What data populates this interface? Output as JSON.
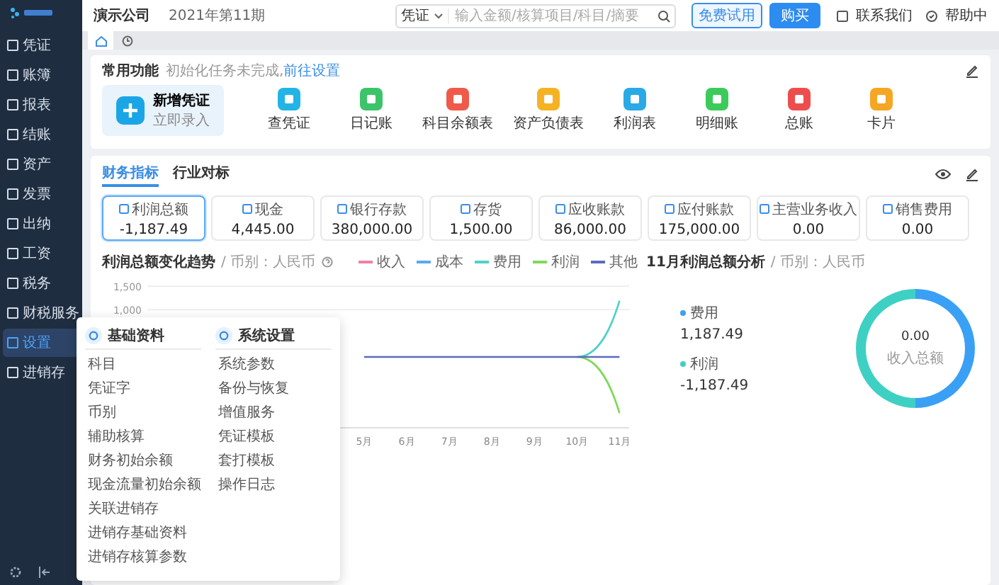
{
  "app": {
    "company": "演示公司",
    "period": "2021年第11期"
  },
  "sidebar": {
    "items": [
      {
        "label": "凭证",
        "selected": false
      },
      {
        "label": "账簿",
        "selected": false
      },
      {
        "label": "报表",
        "selected": false
      },
      {
        "label": "结账",
        "selected": false
      },
      {
        "label": "资产",
        "selected": false
      },
      {
        "label": "发票",
        "selected": false
      },
      {
        "label": "出纳",
        "selected": false
      },
      {
        "label": "工资",
        "selected": false
      },
      {
        "label": "税务",
        "selected": false
      },
      {
        "label": "财税服务",
        "selected": false
      },
      {
        "label": "设置",
        "selected": true
      },
      {
        "label": "进销存",
        "selected": false
      }
    ]
  },
  "search": {
    "scope": "凭证",
    "placeholder": "输入金额/核算项目/科目/摘要"
  },
  "header_actions": {
    "trial_button": "免费试用",
    "buy_button": "购买",
    "contact_link": "联系我们",
    "help_link": "帮助中"
  },
  "quick_functions": {
    "title": "常用功能",
    "hint": "初始化任务未完成,",
    "hint_link": "前往设置",
    "primary": {
      "label": "新增凭证",
      "sublabel": "立即录入"
    },
    "items": [
      {
        "label": "查凭证",
        "color": "#22b4e6"
      },
      {
        "label": "日记账",
        "color": "#3cc46a"
      },
      {
        "label": "科目余额表",
        "color": "#ef5a4a"
      },
      {
        "label": "资产负债表",
        "color": "#f5b324"
      },
      {
        "label": "利润表",
        "color": "#29a9e6"
      },
      {
        "label": "明细账",
        "color": "#3ccb5a"
      },
      {
        "label": "总账",
        "color": "#ee4d4d"
      },
      {
        "label": "卡片",
        "color": "#f5a623"
      }
    ]
  },
  "indicators": {
    "tabs": [
      {
        "label": "财务指标",
        "selected": true
      },
      {
        "label": "行业对标",
        "selected": false
      }
    ],
    "cards": [
      {
        "label": "利润总额",
        "value": "-1,187.49",
        "selected": true
      },
      {
        "label": "现金",
        "value": "4,445.00",
        "selected": false
      },
      {
        "label": "银行存款",
        "value": "380,000.00",
        "selected": false
      },
      {
        "label": "存货",
        "value": "1,500.00",
        "selected": false
      },
      {
        "label": "应收账款",
        "value": "86,000.00",
        "selected": false
      },
      {
        "label": "应付账款",
        "value": "175,000.00",
        "selected": false
      },
      {
        "label": "主营业务收入",
        "value": "0.00",
        "selected": false
      },
      {
        "label": "销售费用",
        "value": "0.00",
        "selected": false
      }
    ]
  },
  "trend_chart": {
    "title": "利润总额变化趋势",
    "unit": "/ 币别：人民币",
    "chart_data": {
      "type": "line",
      "categories": [
        "5月",
        "6月",
        "7月",
        "8月",
        "9月",
        "10月",
        "11月"
      ],
      "ylim": [
        -1500,
        1500
      ],
      "yticks": [
        {
          "value": 1500,
          "label": "1,500"
        },
        {
          "value": 1000,
          "label": "1,000"
        }
      ],
      "series": [
        {
          "name": "收入",
          "color": "#f27fa3",
          "values": [
            null,
            null,
            null,
            null,
            null,
            null,
            null
          ]
        },
        {
          "name": "成本",
          "color": "#5aa9f2",
          "values": [
            null,
            null,
            null,
            null,
            null,
            null,
            null
          ]
        },
        {
          "name": "费用",
          "color": "#4fd1c5",
          "values": [
            null,
            null,
            null,
            null,
            null,
            0,
            1190
          ]
        },
        {
          "name": "利润",
          "color": "#7ed957",
          "values": [
            null,
            null,
            null,
            null,
            null,
            0,
            -1190
          ]
        },
        {
          "name": "其他",
          "color": "#5b6bc0",
          "values": [
            0,
            0,
            0,
            0,
            0,
            0,
            0
          ]
        }
      ]
    }
  },
  "analysis_chart": {
    "title": "11月利润总额分析",
    "unit": "/ 币别：人民币",
    "center_value": "0.00",
    "center_label": "收入总额",
    "legend": [
      {
        "value": "1,187.49",
        "color": "#3aa0f5"
      },
      {
        "value": "-1,187.49",
        "color": "#3fd0c4"
      }
    ],
    "chart_data": {
      "type": "donut",
      "categories": [
        "费用",
        "利润"
      ],
      "values": [
        50,
        50
      ]
    }
  },
  "settings_menu": {
    "columns": [
      {
        "title": "基础资料",
        "items": [
          "科目",
          "凭证字",
          "币别",
          "辅助核算",
          "财务初始余额",
          "现金流量初始余额",
          "关联进销存",
          "进销存基础资料",
          "进销存核算参数"
        ]
      },
      {
        "title": "系统设置",
        "items": [
          "系统参数",
          "备份与恢复",
          "增值服务",
          "凭证模板",
          "套打模板",
          "操作日志"
        ]
      }
    ]
  }
}
